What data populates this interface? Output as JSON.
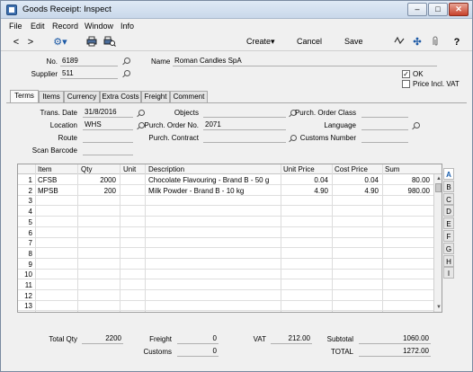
{
  "window": {
    "title": "Goods Receipt: Inspect"
  },
  "menu": [
    "File",
    "Edit",
    "Record",
    "Window",
    "Info"
  ],
  "toolbar": {
    "create": "Create",
    "cancel": "Cancel",
    "save": "Save"
  },
  "header": {
    "no_label": "No.",
    "no_value": "6189",
    "name_label": "Name",
    "name_value": "Roman Candles SpA",
    "supplier_label": "Supplier",
    "supplier_value": "511",
    "ok_label": "OK",
    "ok_checked": true,
    "price_incl_vat_label": "Price Incl. VAT",
    "price_incl_vat_checked": false
  },
  "tabs": [
    "Terms",
    "Items",
    "Currency",
    "Extra Costs",
    "Freight",
    "Comment"
  ],
  "terms": {
    "trans_date_label": "Trans. Date",
    "trans_date": "31/8/2016",
    "objects_label": "Objects",
    "objects": "",
    "purch_order_class_label": "Purch. Order Class",
    "purch_order_class": "",
    "location_label": "Location",
    "location": "WHS",
    "purch_order_no_label": "Purch. Order No.",
    "purch_order_no": "2071",
    "language_label": "Language",
    "language": "",
    "route_label": "Route",
    "route": "",
    "purch_contract_label": "Purch. Contract",
    "purch_contract": "",
    "customs_number_label": "Customs Number",
    "customs_number": "",
    "scan_barcode_label": "Scan Barcode",
    "scan_barcode": ""
  },
  "grid": {
    "columns": [
      "Item",
      "Qty",
      "Unit",
      "Description",
      "Unit Price",
      "Cost Price",
      "Sum"
    ],
    "rows": [
      {
        "n": "1",
        "item": "CFSB",
        "qty": "2000",
        "unit": "",
        "desc": "Chocolate Flavouring - Brand B - 50 g",
        "unit_price": "0.04",
        "cost_price": "0.04",
        "sum": "80.00"
      },
      {
        "n": "2",
        "item": "MPSB",
        "qty": "200",
        "unit": "",
        "desc": "Milk Powder - Brand B - 10 kg",
        "unit_price": "4.90",
        "cost_price": "4.90",
        "sum": "980.00"
      },
      {
        "n": "3"
      },
      {
        "n": "4"
      },
      {
        "n": "5"
      },
      {
        "n": "6"
      },
      {
        "n": "7"
      },
      {
        "n": "8"
      },
      {
        "n": "9"
      },
      {
        "n": "10"
      },
      {
        "n": "11"
      },
      {
        "n": "12"
      },
      {
        "n": "13"
      }
    ],
    "column_tabs": [
      "A",
      "B",
      "C",
      "D",
      "E",
      "F",
      "G",
      "H",
      "I"
    ]
  },
  "footer": {
    "total_qty_label": "Total Qty",
    "total_qty": "2200",
    "freight_label": "Freight",
    "freight": "0",
    "vat_label": "VAT",
    "vat": "212.00",
    "subtotal_label": "Subtotal",
    "subtotal": "1060.00",
    "customs_label": "Customs",
    "customs": "0",
    "total_label": "TOTAL",
    "total": "1272.00"
  }
}
